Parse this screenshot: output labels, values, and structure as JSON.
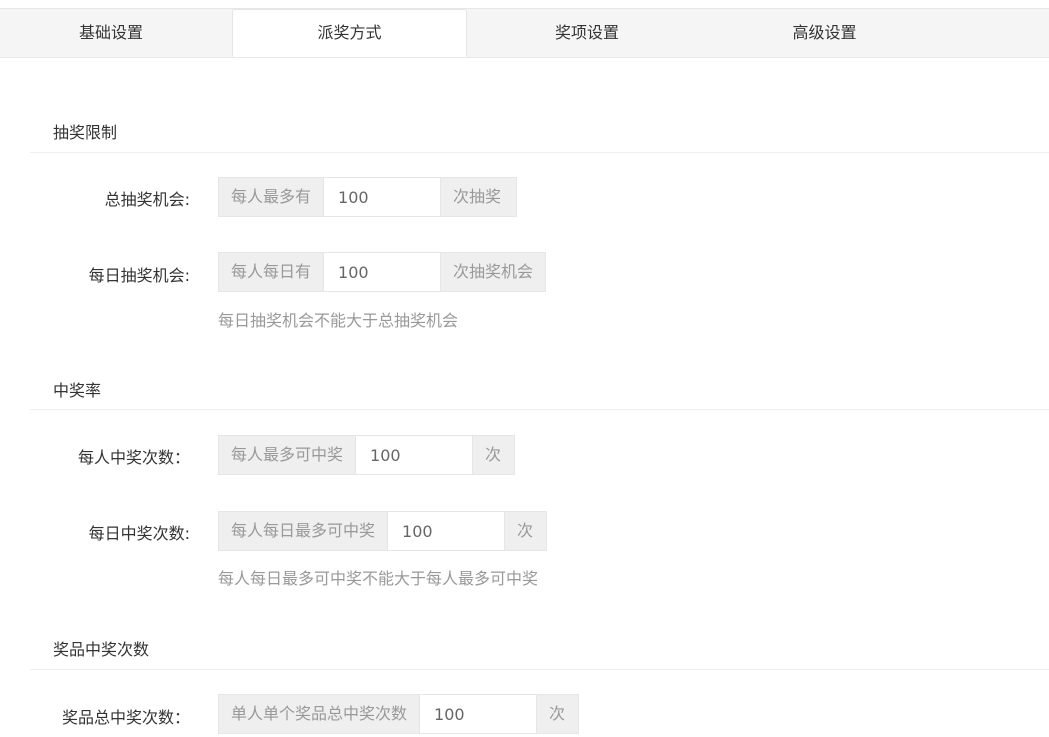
{
  "tabs": [
    {
      "label": "基础设置"
    },
    {
      "label": "派奖方式"
    },
    {
      "label": "奖项设置"
    },
    {
      "label": "高级设置"
    }
  ],
  "sections": {
    "limit": {
      "title": "抽奖限制",
      "total": {
        "label": "总抽奖机会:",
        "prefix": "每人最多有",
        "value": "100",
        "suffix": "次抽奖"
      },
      "daily": {
        "label": "每日抽奖机会:",
        "prefix": "每人每日有",
        "value": "100",
        "suffix": "次抽奖机会",
        "hint": "每日抽奖机会不能大于总抽奖机会"
      }
    },
    "rate": {
      "title": "中奖率",
      "per_person": {
        "label": "每人中奖次数：",
        "prefix": "每人最多可中奖",
        "value": "100",
        "suffix": "次"
      },
      "daily": {
        "label": "每日中奖次数:",
        "prefix": "每人每日最多可中奖",
        "value": "100",
        "suffix": "次",
        "hint": "每人每日最多可中奖不能大于每人最多可中奖"
      }
    },
    "prize": {
      "title": "奖品中奖次数",
      "total": {
        "label": "奖品总中奖次数：",
        "prefix": "单人单个奖品总中奖次数",
        "value": "100",
        "suffix": "次"
      }
    }
  }
}
